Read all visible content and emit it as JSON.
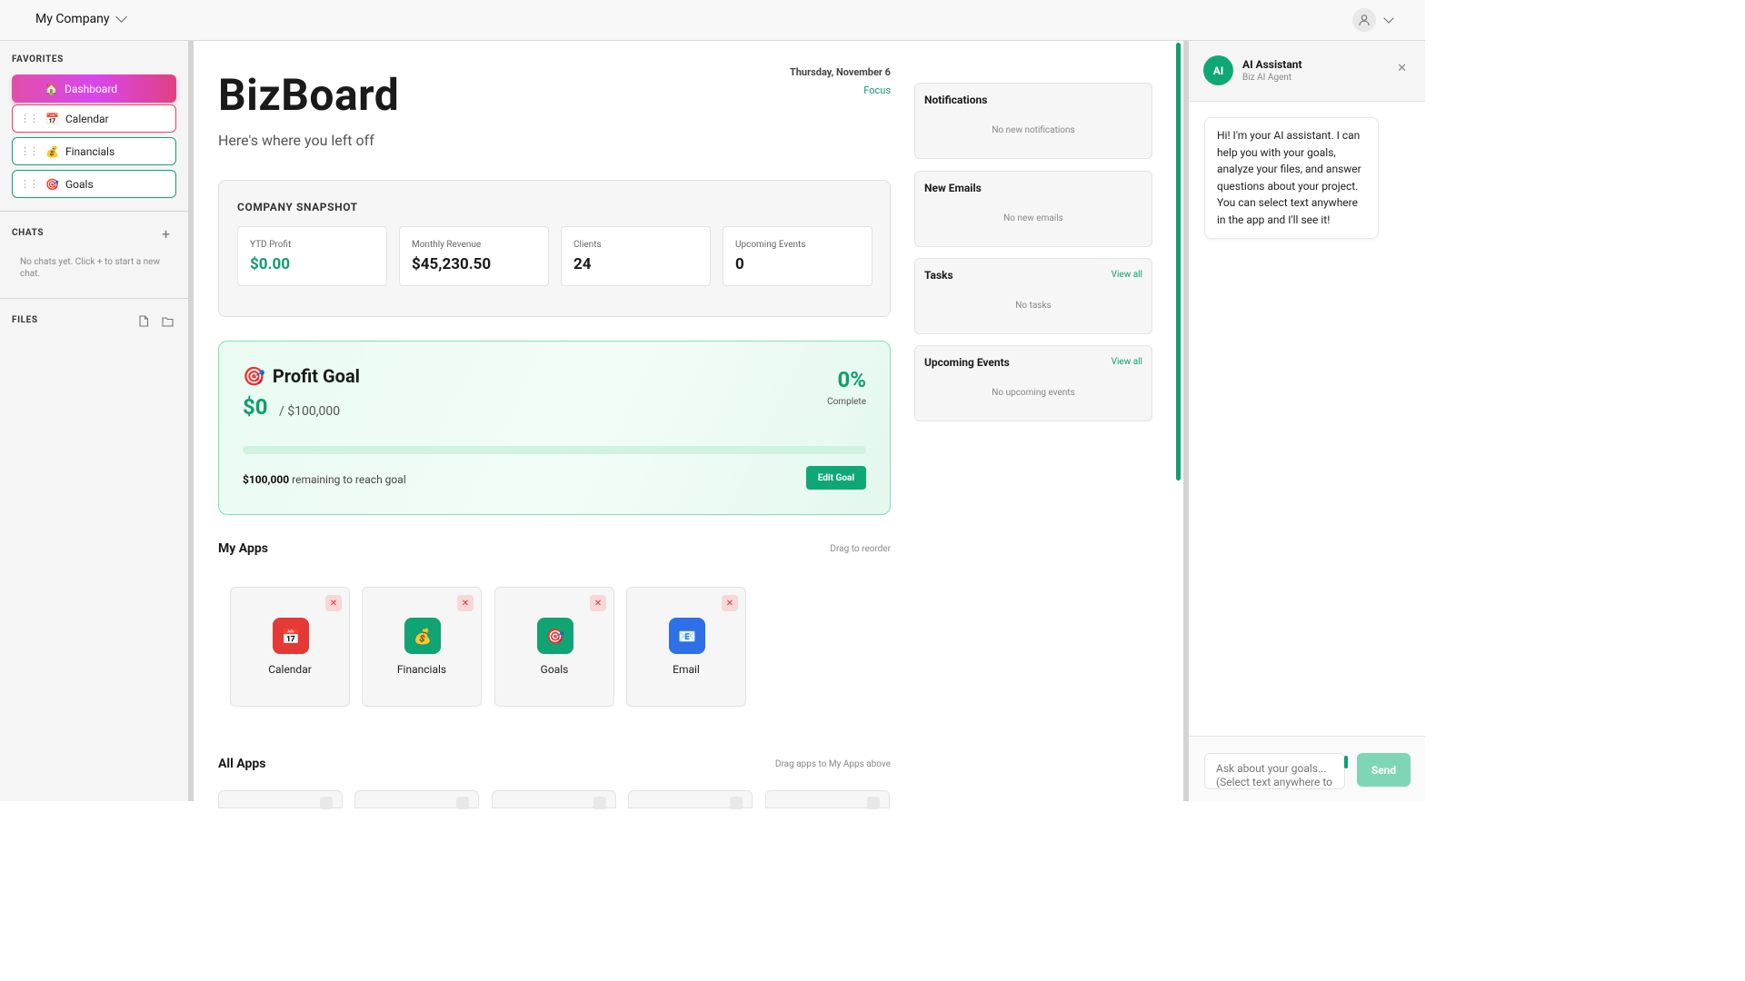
{
  "topbar": {
    "company_name": "My Company"
  },
  "sidebar": {
    "favorites_title": "FAVORITES",
    "favorites": [
      {
        "label": "Dashboard",
        "emoji": "🏠"
      },
      {
        "label": "Calendar",
        "emoji": "📅"
      },
      {
        "label": "Financials",
        "emoji": "💰"
      },
      {
        "label": "Goals",
        "emoji": "🎯"
      }
    ],
    "chats_title": "CHATS",
    "chats_empty": "No chats yet. Click + to start a new chat.",
    "files_title": "FILES"
  },
  "main": {
    "title": "BizBoard",
    "subtitle": "Here's where you left off",
    "date": "Thursday, November 6",
    "focus_link": "Focus",
    "snapshot": {
      "title": "COMPANY SNAPSHOT",
      "stats": [
        {
          "label": "YTD Profit",
          "value": "$0.00"
        },
        {
          "label": "Monthly Revenue",
          "value": "$45,230.50"
        },
        {
          "label": "Clients",
          "value": "24"
        },
        {
          "label": "Upcoming Events",
          "value": "0"
        }
      ]
    },
    "goal": {
      "emoji": "🎯",
      "title": "Profit Goal",
      "current": "$0",
      "target": "/ $100,000",
      "percent": "0%",
      "progress": 0,
      "complete_label": "Complete",
      "remaining_amount": "$100,000",
      "remaining_text": " remaining to reach goal",
      "edit_button": "Edit Goal"
    },
    "my_apps": {
      "title": "My Apps",
      "hint": "Drag to reorder",
      "apps": [
        {
          "label": "Calendar",
          "emoji": "📅",
          "color": "#e53935"
        },
        {
          "label": "Financials",
          "emoji": "💰",
          "color": "#10a374"
        },
        {
          "label": "Goals",
          "emoji": "🎯",
          "color": "#10a374"
        },
        {
          "label": "Email",
          "emoji": "📧",
          "color": "#2f6fe8"
        }
      ]
    },
    "all_apps": {
      "title": "All Apps",
      "hint": "Drag apps to My Apps above"
    }
  },
  "widgets": {
    "notifications": {
      "title": "Notifications",
      "empty": "No new notifications"
    },
    "emails": {
      "title": "New Emails",
      "empty": "No new emails"
    },
    "tasks": {
      "title": "Tasks",
      "link": "View all",
      "empty": "No tasks"
    },
    "events": {
      "title": "Upcoming Events",
      "link": "View all",
      "empty": "No upcoming events"
    }
  },
  "ai": {
    "badge": "AI",
    "name": "AI Assistant",
    "subtitle": "Biz AI Agent",
    "message": "Hi! I'm your AI assistant. I can help you with your goals, analyze your files, and answer questions about your project. You can select text anywhere in the app and I'll see it!",
    "input_placeholder": "Ask about your goals... (Select text anywhere to",
    "send_label": "Send"
  },
  "colors": {
    "accent": "#0e9f6e",
    "dashboard_gradient_start": "#e04fa8",
    "calendar_border": "#e4455d"
  }
}
